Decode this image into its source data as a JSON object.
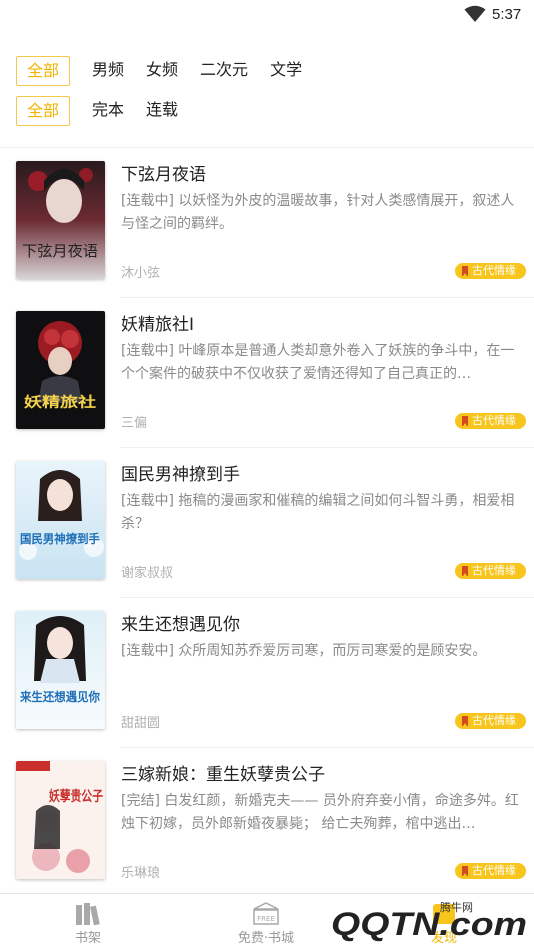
{
  "status_bar": {
    "time": "5:37"
  },
  "filters": {
    "category": [
      {
        "label": "全部",
        "active": true
      },
      {
        "label": "男频"
      },
      {
        "label": "女频"
      },
      {
        "label": "二次元"
      },
      {
        "label": "文学"
      }
    ],
    "status": [
      {
        "label": "全部",
        "active": true
      },
      {
        "label": "完本"
      },
      {
        "label": "连载"
      }
    ]
  },
  "books": [
    {
      "title": "下弦月夜语",
      "description": "[连载中] 以妖怪为外皮的温暖故事，针对人类感情展开，叙述人与怪之间的羁绊。",
      "author": "沐小弦",
      "tag": "古代情缘",
      "cover_text": "下弦月夜语"
    },
    {
      "title": "妖精旅社I",
      "description": "[连载中] 叶峰原本是普通人类却意外卷入了妖族的争斗中，在一个个案件的破获中不仅收获了爱情还得知了自己真正的…",
      "author": "三偏",
      "tag": "古代情缘",
      "cover_text": "妖精旅社"
    },
    {
      "title": "国民男神撩到手",
      "description": "[连载中] 拖稿的漫画家和催稿的编辑之间如何斗智斗勇，相爱相杀？",
      "author": "谢家叔叔",
      "tag": "古代情缘",
      "cover_text": "国民男神撩到手"
    },
    {
      "title": "来生还想遇见你",
      "description": "[连载中] 众所周知苏乔爱厉司寒，而厉司寒爱的是顾安安。",
      "author": "甜甜圆",
      "tag": "古代情缘",
      "cover_text": "来生还想遇见你"
    },
    {
      "title": "三嫁新娘：重生妖孽贵公子",
      "description": "[完结] 白发红颜，新婚克夫—— 员外府弃妾小倩，命途多舛。红烛下初嫁，员外郎新婚夜暴毙； 给亡夫殉葬，棺中逃出…",
      "author": "乐琳琅",
      "tag": "古代情缘",
      "cover_text": "妖孽贵公子"
    }
  ],
  "tab_bar": {
    "tabs": [
      {
        "label": "书架",
        "icon": "bookshelf-icon"
      },
      {
        "label": "免费·书城",
        "icon": "free-bookstore-icon",
        "icon_text": "FREE"
      },
      {
        "label": "发现",
        "icon": "discover-icon"
      }
    ]
  },
  "watermark": {
    "text": "QQTN.com",
    "brand": "腾牛网"
  },
  "colors": {
    "accent": "#f7c51c",
    "active_text": "#f0b400"
  }
}
